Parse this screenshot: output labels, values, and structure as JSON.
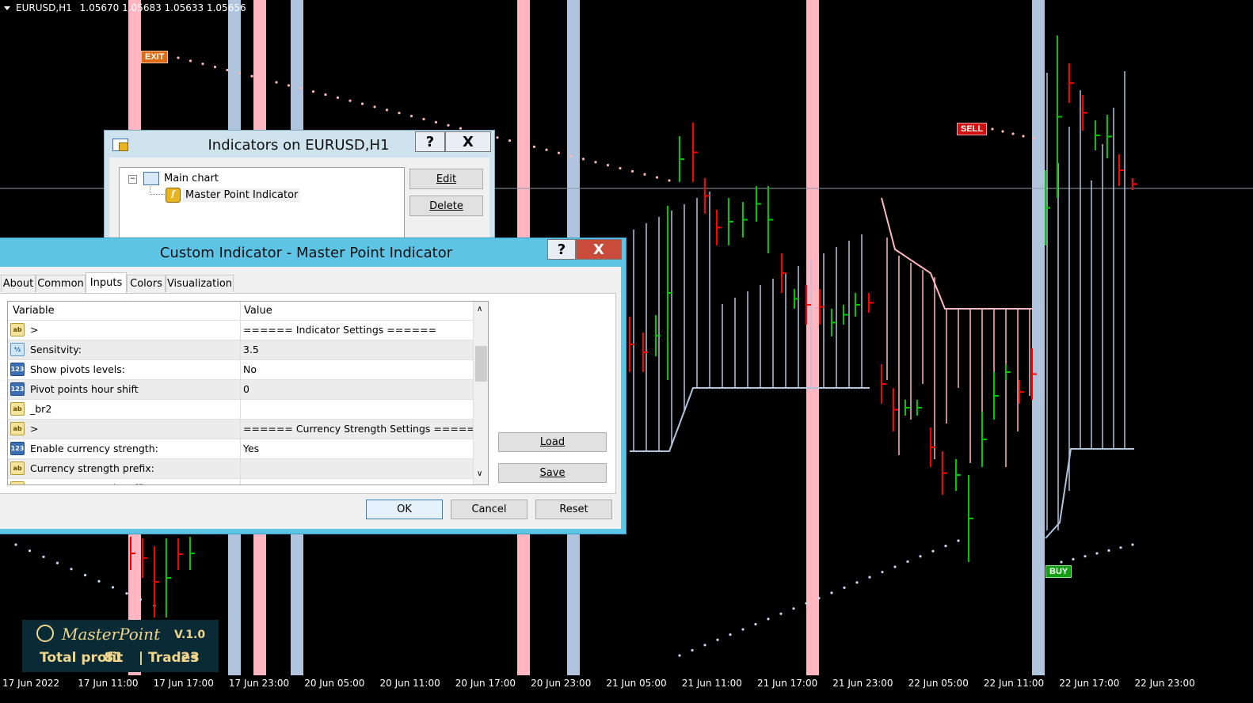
{
  "chart": {
    "symbol": "EURUSD,H1",
    "prices": "1.05670 1.05683 1.05633 1.05656",
    "signals": {
      "exit": "EXIT",
      "sell": "SELL",
      "buy": "BUY"
    },
    "time_labels": [
      "17 Jun 2022",
      "17 Jun 11:00",
      "17 Jun 17:00",
      "17 Jun 23:00",
      "20 Jun 05:00",
      "20 Jun 11:00",
      "20 Jun 17:00",
      "20 Jun 23:00",
      "21 Jun 05:00",
      "21 Jun 11:00",
      "21 Jun 17:00",
      "21 Jun 23:00",
      "22 Jun 05:00",
      "22 Jun 11:00",
      "22 Jun 17:00",
      "22 Jun 23:00"
    ],
    "colors": {
      "bull": "#00c800",
      "bear": "#ff0000",
      "pink_band": "#ffb6c1",
      "blue_band": "#b0c4de"
    }
  },
  "overlay": {
    "brand": "MasterPoint",
    "version": "V.1.0",
    "profit_label": "Total profit",
    "profit_value": "81",
    "trades_label": "| Trades",
    "trades_value": "23"
  },
  "indicators_window": {
    "title": "Indicators on EURUSD,H1",
    "help": "?",
    "close": "X",
    "tree": {
      "root": "Main chart",
      "child": "Master Point Indicator",
      "expander": "−"
    },
    "edit": "Edit",
    "delete": "Delete"
  },
  "custom_window": {
    "title": "Custom Indicator - Master Point Indicator",
    "help": "?",
    "close": "X",
    "tabs": [
      "About",
      "Common",
      "Inputs",
      "Colors",
      "Visualization"
    ],
    "active_tab": "Inputs",
    "columns": {
      "variable": "Variable",
      "value": "Value"
    },
    "rows": [
      {
        "icon": "ab",
        "variable": ">",
        "value": "====== Indicator Settings ======"
      },
      {
        "icon": "dbl",
        "variable": "Sensitvity:",
        "value": "3.5"
      },
      {
        "icon": "num",
        "variable": "Show pivots levels:",
        "value": "No"
      },
      {
        "icon": "num",
        "variable": "Pivot points hour shift",
        "value": "0"
      },
      {
        "icon": "ab",
        "variable": "_br2",
        "value": ""
      },
      {
        "icon": "ab",
        "variable": ">",
        "value": "====== Currency Strength Settings ======"
      },
      {
        "icon": "num",
        "variable": "Enable currency strength:",
        "value": "Yes"
      },
      {
        "icon": "ab",
        "variable": "Currency strength prefix:",
        "value": ""
      },
      {
        "icon": "ab",
        "variable": "Currency strength suffix:",
        "value": ""
      }
    ],
    "icon_labels": {
      "ab": "ab",
      "num": "123",
      "dbl": "½"
    },
    "load": "Load",
    "save": "Save",
    "ok": "OK",
    "cancel": "Cancel",
    "reset": "Reset"
  }
}
